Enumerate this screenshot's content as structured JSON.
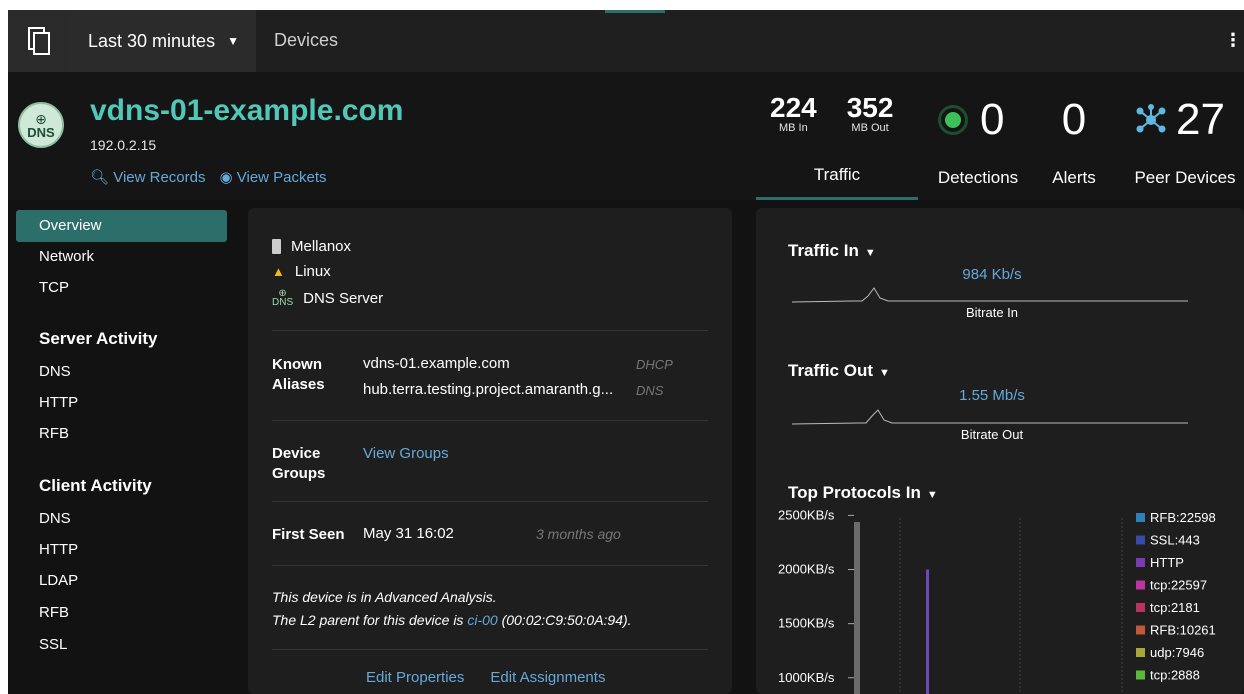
{
  "topbar": {
    "time_range": "Last 30 minutes",
    "breadcrumb": "Devices",
    "menu_icon": "devices-icon",
    "more_icon": "kebab-icon"
  },
  "device": {
    "badge": "DNS",
    "name": "vdns-01-example.com",
    "ip": "192.0.2.15",
    "links": {
      "records": "View Records",
      "packets": "View Packets"
    }
  },
  "metrics": {
    "mb_in": "224",
    "mb_in_label": "MB In",
    "mb_out": "352",
    "mb_out_label": "MB Out",
    "traffic_label": "Traffic",
    "detections": "0",
    "detections_label": "Detections",
    "alerts": "0",
    "alerts_label": "Alerts",
    "peers": "27",
    "peers_label": "Peer Devices"
  },
  "nav": {
    "items": [
      "Overview",
      "Network",
      "TCP"
    ],
    "server_heading": "Server Activity",
    "server_items": [
      "DNS",
      "HTTP",
      "RFB"
    ],
    "client_heading": "Client Activity",
    "client_items": [
      "DNS",
      "HTTP",
      "LDAP",
      "RFB",
      "SSL"
    ]
  },
  "details": {
    "vendor": "Mellanox",
    "os": "Linux",
    "role": "DNS Server",
    "aliases_label": "Known Aliases",
    "aliases": [
      {
        "name": "vdns-01.example.com",
        "source": "DHCP"
      },
      {
        "name": "hub.terra.testing.project.amaranth.g...",
        "source": "DNS"
      }
    ],
    "groups_label": "Device Groups",
    "groups_link": "View Groups",
    "first_seen_label": "First Seen",
    "first_seen": "May 31 16:02",
    "first_seen_relative": "3 months ago",
    "note1": "This device is in Advanced Analysis.",
    "note2_pre": "The L2 parent for this device is ",
    "note2_link": "ci-00",
    "note2_post": " (00:02:C9:50:0A:94).",
    "edit_properties": "Edit Properties",
    "edit_assignments": "Edit Assignments"
  },
  "traffic_in": {
    "title": "Traffic In",
    "rate": "984 Kb/s",
    "label": "Bitrate In"
  },
  "traffic_out": {
    "title": "Traffic Out",
    "rate": "1.55 Mb/s",
    "label": "Bitrate Out"
  },
  "protocols": {
    "title": "Top Protocols In"
  },
  "chart_data": {
    "type": "bar",
    "title": "Top Protocols In",
    "y_ticks": [
      "2500KB/s",
      "2000KB/s",
      "1500KB/s",
      "1000KB/s"
    ],
    "y_tick_values": [
      2500,
      2000,
      1500,
      1000
    ],
    "ylim": [
      850,
      2550
    ],
    "spike_value": 2000,
    "series": [
      {
        "name": "RFB:22598",
        "color": "#2f7fb8"
      },
      {
        "name": "SSL:443",
        "color": "#3a4aa8"
      },
      {
        "name": "HTTP",
        "color": "#7a3ab0"
      },
      {
        "name": "tcp:22597",
        "color": "#b8369e"
      },
      {
        "name": "tcp:2181",
        "color": "#b83262"
      },
      {
        "name": "RFB:10261",
        "color": "#c05a3a"
      },
      {
        "name": "udp:7946",
        "color": "#a8a83a"
      },
      {
        "name": "tcp:2888",
        "color": "#5ab83a"
      }
    ]
  }
}
